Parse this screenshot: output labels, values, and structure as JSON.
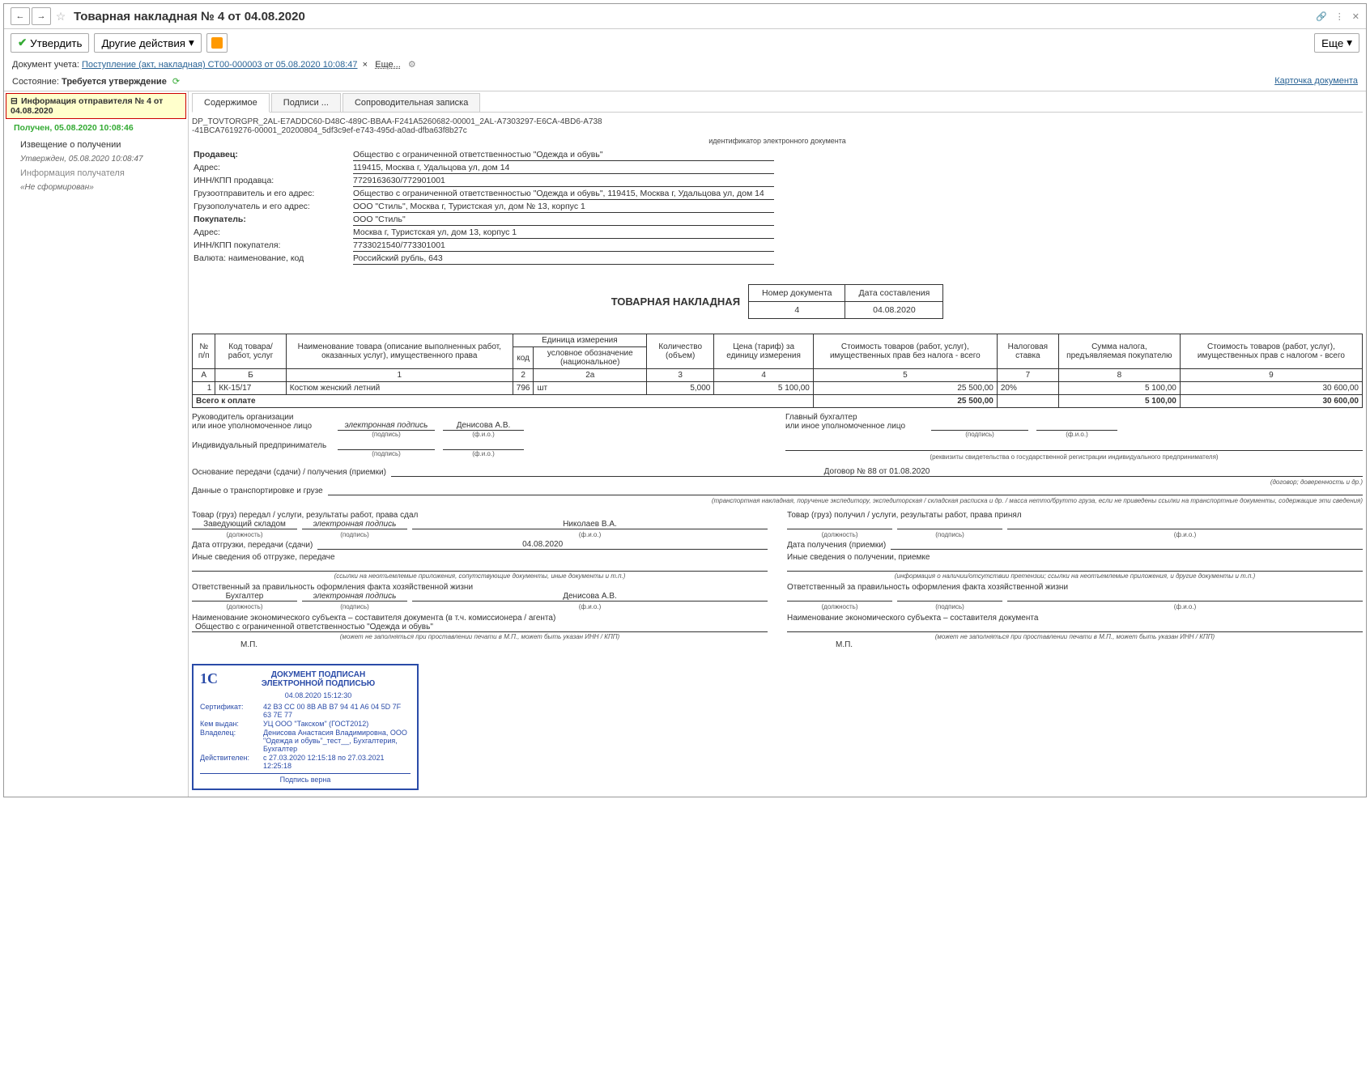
{
  "titlebar": {
    "title": "Товарная накладная № 4 от 04.08.2020"
  },
  "toolbar": {
    "approve": "Утвердить",
    "other_actions": "Другие действия",
    "more": "Еще"
  },
  "infobar": {
    "doc_label": "Документ учета:",
    "doc_link": "Поступление (акт, накладная) СТ00-000003 от 05.08.2020 10:08:47",
    "more_link": "Еще..."
  },
  "statebar": {
    "label": "Состояние:",
    "value": "Требуется утверждение",
    "card_link": "Карточка документа"
  },
  "sidebar": {
    "header": "Информация отправителя № 4 от 04.08.2020",
    "status": "Получен, 05.08.2020 10:08:46",
    "items": [
      {
        "label": "Извещение о получении",
        "sub": "Утвержден, 05.08.2020 10:08:47"
      },
      {
        "label": "Информация получателя",
        "sub": "«Не сформирован»"
      }
    ]
  },
  "tabs": [
    "Содержимое",
    "Подписи ...",
    "Сопроводительная записка"
  ],
  "doc_id": [
    "DP_TOVTORGPR_2AL-E7ADDC60-D48C-489C-BBAA-F241A5260682-00001_2AL-A7303297-E6CA-4BD6-A738",
    "-41BCA7619276-00001_20200804_5df3c9ef-e743-495d-a0ad-dfba63f8b27c"
  ],
  "ident_label": "идентификатор электронного документа",
  "header_info": {
    "seller_lbl": "Продавец:",
    "seller": "Общество с ограниченной ответственностью \"Одежда и обувь\"",
    "addr_lbl": "Адрес:",
    "addr": "119415, Москва г, Удальцова ул, дом 14",
    "innkpp_lbl": "ИНН/КПП продавца:",
    "innkpp": "7729163630/772901001",
    "shipper_lbl": "Грузоотправитель и его адрес:",
    "shipper": "Общество с ограниченной ответственностью \"Одежда и обувь\", 119415, Москва г, Удальцова ул, дом 14",
    "consignee_lbl": "Грузополучатель и его адрес:",
    "consignee": "ООО \"Стиль\", Москва г, Туристская ул, дом № 13, корпус 1",
    "buyer_lbl": "Покупатель:",
    "buyer": "ООО \"Стиль\"",
    "baddr_lbl": "Адрес:",
    "baddr": "Москва г, Туристская ул, дом 13, корпус 1",
    "binnkpp_lbl": "ИНН/КПП покупателя:",
    "binnkpp": "7733021540/773301001",
    "currency_lbl": "Валюта: наименование, код",
    "currency": "Российский рубль, 643"
  },
  "doc_title": "ТОВАРНАЯ НАКЛАДНАЯ",
  "numdate": {
    "num_hdr": "Номер документа",
    "date_hdr": "Дата составления",
    "num": "4",
    "date": "04.08.2020"
  },
  "items_header": {
    "n": "№ п/п",
    "code": "Код товара/ работ, услуг",
    "name": "Наименование товара (описание выполненных работ, оказанных услуг), имущественного права",
    "unit": "Единица измерения",
    "unit_code": "код",
    "unit_name": "условное обозначение (национальное)",
    "qty": "Количество (объем)",
    "price": "Цена (тариф) за единицу измерения",
    "cost_notax": "Стоимость товаров (работ, услуг), имущественных прав без налога - всего",
    "tax_rate": "Налоговая ставка",
    "tax_sum": "Сумма налога, предъявляемая покупателю",
    "cost_tax": "Стоимость товаров (работ, услуг), имущественных прав с налогом - всего",
    "col_ids": {
      "a": "А",
      "b": "Б",
      "c1": "1",
      "c2": "2",
      "c2a": "2а",
      "c3": "3",
      "c4": "4",
      "c5": "5",
      "c7": "7",
      "c8": "8",
      "c9": "9"
    }
  },
  "items": [
    {
      "n": "1",
      "code": "КК-15/17",
      "name": "Костюм женский летний",
      "ucode": "796",
      "uname": "шт",
      "qty": "5,000",
      "price": "5 100,00",
      "cost_notax": "25 500,00",
      "tax_rate": "20%",
      "tax_sum": "5 100,00",
      "cost_tax": "30 600,00"
    }
  ],
  "total": {
    "label": "Всего к оплате",
    "cost_notax": "25 500,00",
    "tax_sum": "5 100,00",
    "cost_tax": "30 600,00"
  },
  "sig": {
    "head_lbl": "Руководитель организации\nили иное уполномоченное лицо",
    "accountant_lbl": "Главный бухгалтер\nили иное уполномоченное лицо",
    "esig": "электронная подпись",
    "denisova": "Денисова А.В.",
    "sig_tiny": "(подпись)",
    "fio_tiny": "(ф.и.о.)",
    "ip_lbl": "Индивидуальный предприниматель",
    "ip_note": "(реквизиты свидетельства о государственной регистрации индивидуального предпринимателя)"
  },
  "transfer": {
    "basis_lbl": "Основание передачи (сдачи) / получения (приемки)",
    "basis_val": "Договор № 88 от 01.08.2020",
    "basis_note": "(договор; доверенность и др.)",
    "transport_lbl": "Данные о транспортировке и грузе",
    "transport_note": "(транспортная накладная, поручение экспедитору, экспедиторская / складская расписка и др. / масса нетто/брутто груза, если не приведены ссылки на транспортные документы, содержащие эти сведения)"
  },
  "left_block": {
    "title": "Товар (груз) передал / услуги, результаты работ, права сдал",
    "job": "Заведующий складом",
    "esig": "электронная подпись",
    "person": "Николаев В.А.",
    "job_tiny": "(должность)",
    "date_lbl": "Дата отгрузки, передачи (сдачи)",
    "date_val": "04.08.2020",
    "other_lbl": "Иные сведения об отгрузке, передаче",
    "other_note": "(ссылки на неотъемлемые приложения, сопутствующие документы, иные документы и т.п.)",
    "resp_lbl": "Ответственный за правильность оформления факта хозяйственной жизни",
    "resp_job": "Бухгалтер",
    "resp_person": "Денисова А.В.",
    "org_lbl": "Наименование экономического субъекта – составителя документа (в т.ч. комиссионера / агента)",
    "org_val": "Общество с ограниченной ответственностью \"Одежда и обувь\"",
    "org_note": "(может не заполняться при проставлении печати в М.П., может быть указан ИНН / КПП)",
    "mp": "М.П."
  },
  "right_block": {
    "title": "Товар (груз) получил / услуги, результаты работ, права принял",
    "date_lbl": "Дата получения (приемки)",
    "other_lbl": "Иные сведения о получении, приемке",
    "other_note": "(информация о наличии/отсутствии претензии; ссылки на неотъемлемые приложения, и другие документы и т.п.)",
    "resp_lbl": "Ответственный за правильность оформления факта хозяйственной жизни",
    "org_lbl": "Наименование экономического субъекта – составителя документа",
    "org_note": "(может не заполняться при проставлении печати в М.П., может быть указан ИНН / КПП)",
    "mp": "М.П."
  },
  "stamp": {
    "logo": "1С",
    "hdr1": "ДОКУМЕНТ ПОДПИСАН",
    "hdr2": "ЭЛЕКТРОННОЙ ПОДПИСЬЮ",
    "ts": "04.08.2020 15:12:30",
    "cert_lbl": "Сертификат:",
    "cert": "42 B3 CC 00 8B AB B7 94 41 A6 04 5D 7F 63 7E 77",
    "issuer_lbl": "Кем выдан:",
    "issuer": "УЦ ООО \"Такском\" (ГОСТ2012)",
    "owner_lbl": "Владелец:",
    "owner": "Денисова Анастасия Владимировна, ООО \"Одежда и обувь\"_тест__, Бухгалтерия, Бухгалтер",
    "valid_lbl": "Действителен:",
    "valid": "с 27.03.2020 12:15:18 по 27.03.2021 12:25:18",
    "foot": "Подпись верна"
  }
}
